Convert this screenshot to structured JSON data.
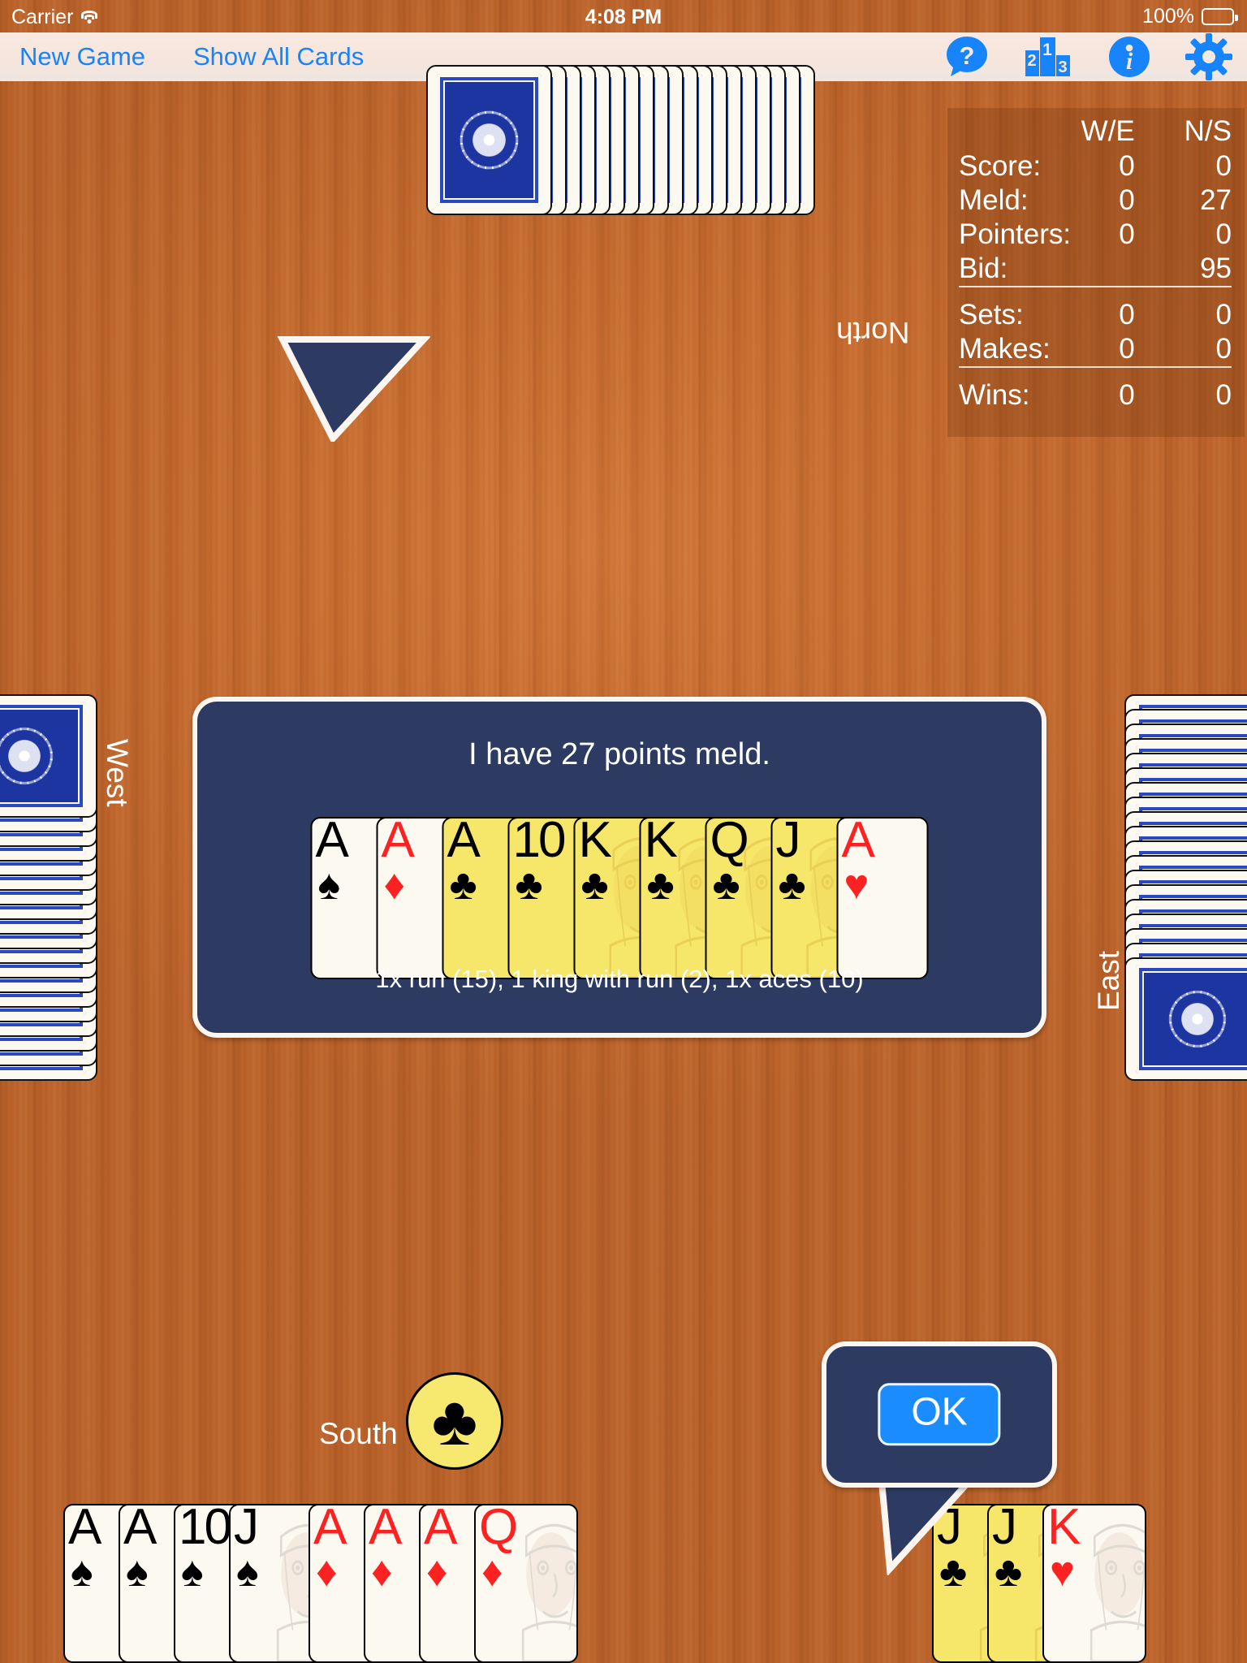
{
  "status_bar": {
    "carrier": "Carrier",
    "wifi_icon": "wifi-icon",
    "time": "4:08 PM",
    "battery_percent": "100%",
    "battery_icon": "battery-full-icon"
  },
  "toolbar": {
    "new_game_label": "New Game",
    "show_all_cards_label": "Show All Cards",
    "icons": [
      {
        "name": "help-icon",
        "title": "Help"
      },
      {
        "name": "leaderboard-icon",
        "title": "Leaderboard"
      },
      {
        "name": "info-icon",
        "title": "Info"
      },
      {
        "name": "settings-gear-icon",
        "title": "Settings"
      }
    ]
  },
  "scoreboard": {
    "columns": [
      "",
      "W/E",
      "N/S"
    ],
    "rows": [
      {
        "label": "Score:",
        "we": "0",
        "ns": "0"
      },
      {
        "label": "Meld:",
        "we": "0",
        "ns": "27"
      },
      {
        "label": "Pointers:",
        "we": "0",
        "ns": "0"
      },
      {
        "label": "Bid:",
        "we": "",
        "ns": "95"
      }
    ],
    "rows2": [
      {
        "label": "Sets:",
        "we": "0",
        "ns": "0"
      },
      {
        "label": "Makes:",
        "we": "0",
        "ns": "0"
      }
    ],
    "rows3": [
      {
        "label": "Wins:",
        "we": "0",
        "ns": "0"
      }
    ]
  },
  "seats": {
    "north": "North",
    "west": "West",
    "east": "East",
    "south": "South"
  },
  "trump": {
    "suit_name": "clubs",
    "glyph": "♣",
    "badge_color": "#f7e870"
  },
  "meld_bubble": {
    "title": "I have 27 points meld.",
    "footer": "1x run (15), 1 king with run (2), 1x aces (10)",
    "cards": [
      {
        "rank": "A",
        "suit": "♠",
        "color": "black",
        "trump": false,
        "face": "none"
      },
      {
        "rank": "A",
        "suit": "♦",
        "color": "red",
        "trump": false,
        "face": "none"
      },
      {
        "rank": "A",
        "suit": "♣",
        "color": "black",
        "trump": true,
        "face": "none"
      },
      {
        "rank": "10",
        "suit": "♣",
        "color": "black",
        "trump": true,
        "face": "none"
      },
      {
        "rank": "K",
        "suit": "♣",
        "color": "black",
        "trump": true,
        "face": "king"
      },
      {
        "rank": "K",
        "suit": "♣",
        "color": "black",
        "trump": true,
        "face": "king"
      },
      {
        "rank": "Q",
        "suit": "♣",
        "color": "black",
        "trump": true,
        "face": "queen"
      },
      {
        "rank": "J",
        "suit": "♣",
        "color": "black",
        "trump": true,
        "face": "jack"
      },
      {
        "rank": "A",
        "suit": "♥",
        "color": "red",
        "trump": false,
        "face": "none"
      }
    ]
  },
  "ok_bubble": {
    "button_label": "OK",
    "button_color": "#1b8cfd"
  },
  "south_hand": {
    "cards": [
      {
        "rank": "A",
        "suit": "♠",
        "color": "black",
        "trump": false,
        "face": "none"
      },
      {
        "rank": "A",
        "suit": "♠",
        "color": "black",
        "trump": false,
        "face": "none"
      },
      {
        "rank": "10",
        "suit": "♠",
        "color": "black",
        "trump": false,
        "face": "none"
      },
      {
        "rank": "J",
        "suit": "♠",
        "color": "black",
        "trump": false,
        "face": "jack"
      },
      {
        "rank": "A",
        "suit": "♦",
        "color": "red",
        "trump": false,
        "face": "none"
      },
      {
        "rank": "A",
        "suit": "♦",
        "color": "red",
        "trump": false,
        "face": "none"
      },
      {
        "rank": "A",
        "suit": "♦",
        "color": "red",
        "trump": false,
        "face": "none"
      },
      {
        "rank": "Q",
        "suit": "♦",
        "color": "red",
        "trump": false,
        "face": "queen"
      }
    ]
  },
  "south_hand_right": {
    "cards": [
      {
        "rank": "J",
        "suit": "♣",
        "color": "black",
        "trump": true,
        "face": "jack"
      },
      {
        "rank": "J",
        "suit": "♣",
        "color": "black",
        "trump": true,
        "face": "jack"
      },
      {
        "rank": "K",
        "suit": "♥",
        "color": "red",
        "trump": false,
        "face": "king"
      }
    ]
  },
  "opponent_stacks": {
    "north_count": 19,
    "west_count": 19,
    "east_count": 19
  },
  "colors": {
    "table_felt": "#c4692d",
    "bubble_bg": "#2d3b63",
    "bubble_border": "#fdf6f0",
    "tint_blue": "#1784fb",
    "trump_card": "#f6e66a",
    "card_face": "#fbf9f0"
  }
}
